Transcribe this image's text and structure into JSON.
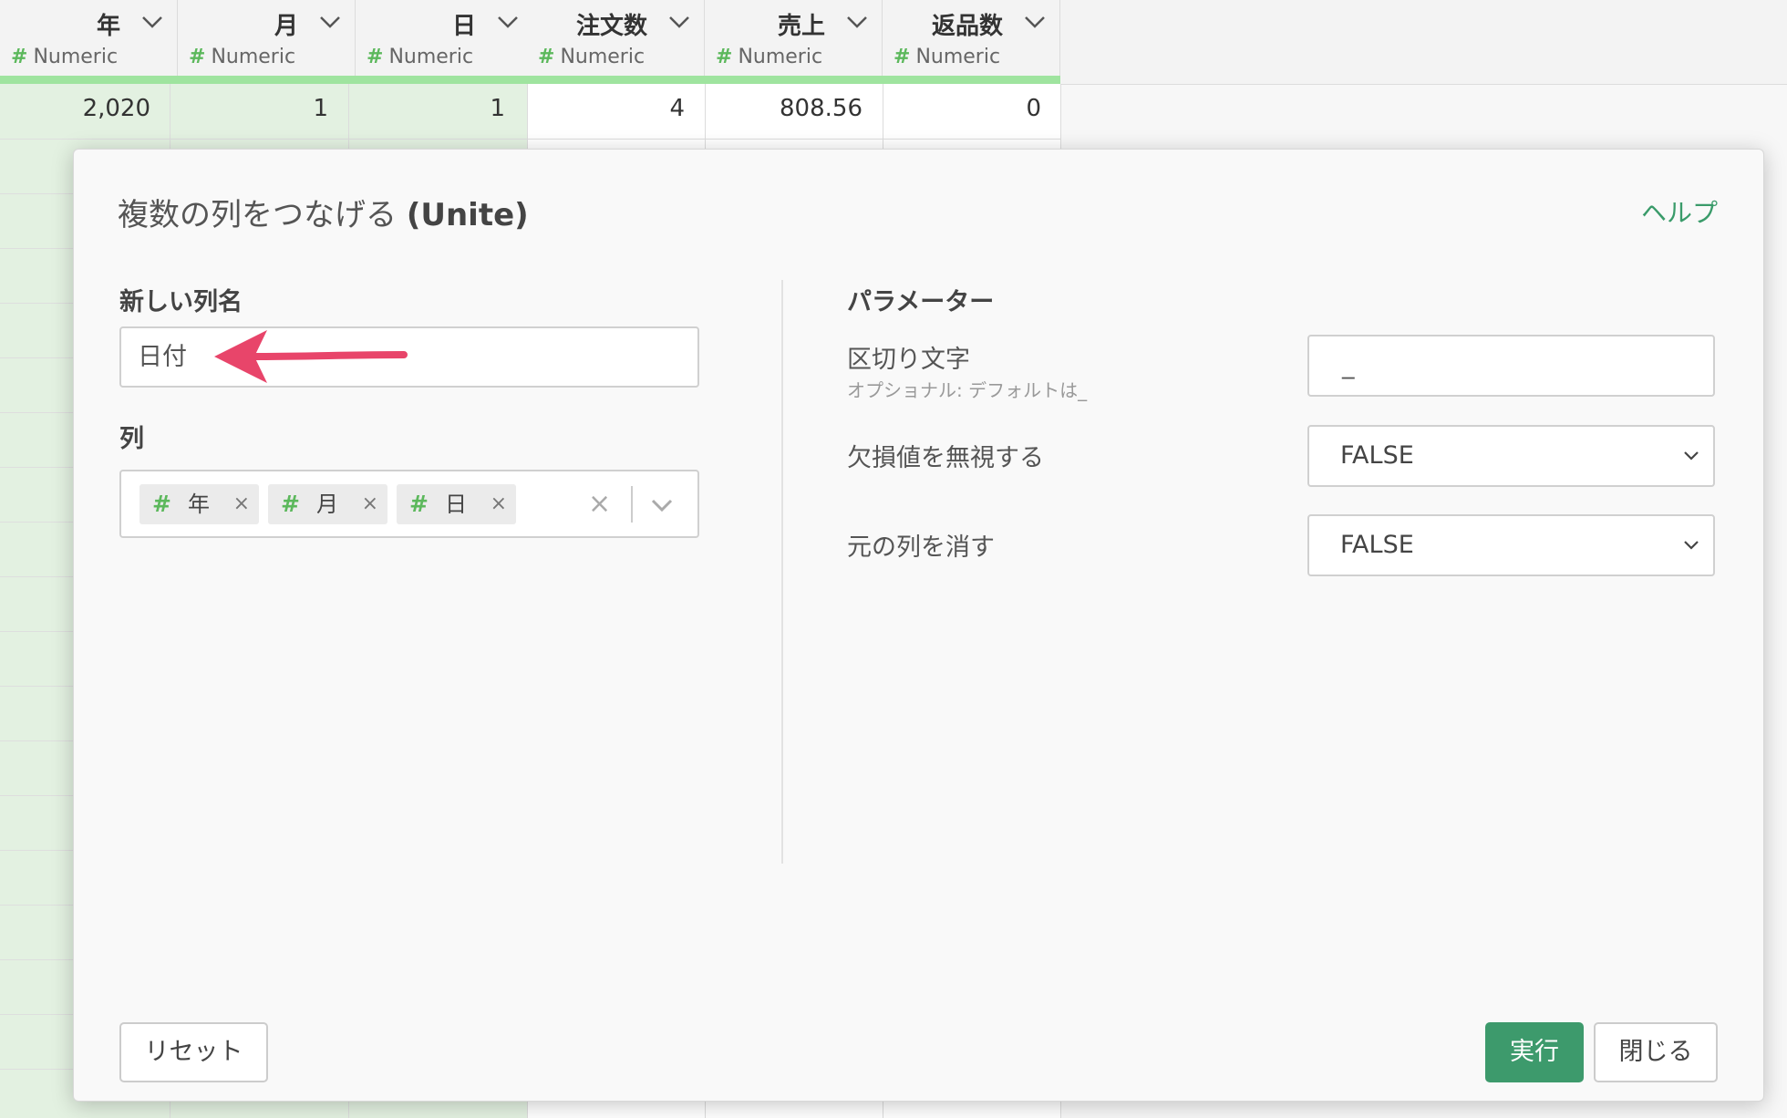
{
  "grid": {
    "columns": [
      {
        "name": "年",
        "type": "Numeric",
        "value": "2,020"
      },
      {
        "name": "月",
        "type": "Numeric",
        "value": "1"
      },
      {
        "name": "日",
        "type": "Numeric",
        "value": "1"
      },
      {
        "name": "注文数",
        "type": "Numeric",
        "value": "4"
      },
      {
        "name": "売上",
        "type": "Numeric",
        "value": "808.56"
      },
      {
        "name": "返品数",
        "type": "Numeric",
        "value": "0"
      }
    ],
    "type_hash": "#"
  },
  "modal": {
    "title_prefix": "複数の列をつなげる",
    "title_suffix": "(Unite)",
    "help_link": "ヘルプ",
    "new_column": {
      "label": "新しい列名",
      "value": "日付"
    },
    "columns_field": {
      "label": "列",
      "chips": [
        {
          "hash": "#",
          "label": "年",
          "remove": "×"
        },
        {
          "hash": "#",
          "label": "月",
          "remove": "×"
        },
        {
          "hash": "#",
          "label": "日",
          "remove": "×"
        }
      ],
      "clear": "×"
    },
    "parameters": {
      "heading": "パラメーター",
      "separator": {
        "label": "区切り文字",
        "hint": "オプショナル: デフォルトは_",
        "value": "_"
      },
      "ignore_na": {
        "label": "欠損値を無視する",
        "value": "FALSE"
      },
      "remove_original": {
        "label": "元の列を消す",
        "value": "FALSE"
      }
    },
    "buttons": {
      "reset": "リセット",
      "run": "実行",
      "close": "閉じる"
    }
  },
  "colors": {
    "accent_green": "#3d9a6c",
    "numeric_hash": "#5cb85c",
    "annotation_arrow": "#e8456a"
  }
}
